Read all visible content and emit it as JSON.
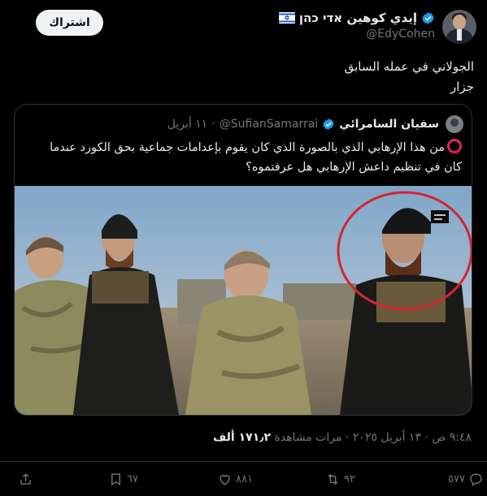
{
  "author": {
    "display_name": "إيدي كوهين אדי כהן",
    "handle": "@EdyCohen",
    "flag_icon": "israel-flag-icon",
    "verified_color": "#1d9bf0"
  },
  "subscribe_label": "اشتراك",
  "tweet": {
    "lines": [
      "الجولاني في عمله السابق",
      "جزار"
    ]
  },
  "quote": {
    "name": "سفيان السامرائي",
    "handle": "@SufianSamarrai",
    "separator": "·",
    "date": "١١ أبريل",
    "line1": "من هذا  الإرهابي الذي بالصورة الذي كان يقوم بإعدامات جماعية بحق الكورد عندما",
    "line2": "كان في تنظيم داعش الإرهابي  هل عرفتموه؟",
    "emoji_color": "#e0245e",
    "circle_color": "#d8242f"
  },
  "meta": {
    "time": "٩:٤٨ ص",
    "sep1": "·",
    "date": "١٣ أبريل ٢٠٢٥",
    "sep2": "·",
    "views_count": "١٧١٫٢ ألف",
    "views_label": "مرات مشاهدة"
  },
  "actions": {
    "replies": "٥٧٧",
    "reposts": "٩٢",
    "likes": "٨٨١",
    "bookmarks": "٦٧"
  }
}
